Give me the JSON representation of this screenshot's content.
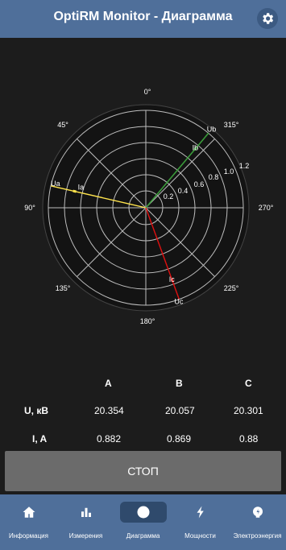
{
  "appbar": {
    "title": "OptiRM Monitor - Диаграмма",
    "settings_icon": "gear-icon"
  },
  "diagram": {
    "angle_labels": {
      "a0": "0°",
      "a45": "45°",
      "a90": "90°",
      "a135": "135°",
      "a180": "180°",
      "a225": "225°",
      "a270": "270°",
      "a315": "315°"
    },
    "radius_labels": [
      "0.2",
      "0.4",
      "0.6",
      "0.8",
      "1.0",
      "1.2"
    ],
    "vectors": {
      "Ua": {
        "label": "Ua",
        "angle_deg": 77,
        "magnitude": 1.2,
        "color": "#ffe44d"
      },
      "Ia": {
        "label": "Ia",
        "angle_deg": 77,
        "magnitude": 0.9,
        "color": "#ffe44d"
      },
      "Ub": {
        "label": "Ub",
        "angle_deg": 320,
        "magnitude": 1.2,
        "color": "#3a9a3a"
      },
      "Ib": {
        "label": "Ib",
        "angle_deg": 320,
        "magnitude": 0.95,
        "color": "#3a9a3a"
      },
      "Uc": {
        "label": "Uc",
        "angle_deg": 200,
        "magnitude": 1.2,
        "color": "#e01010"
      },
      "Ic": {
        "label": "Ic",
        "angle_deg": 200,
        "magnitude": 0.95,
        "color": "#e01010"
      }
    }
  },
  "table": {
    "headers": {
      "a": "A",
      "b": "B",
      "c": "C"
    },
    "rows": [
      {
        "label": "U, кВ",
        "a": "20.354",
        "b": "20.057",
        "c": "20.301"
      },
      {
        "label": "I, A",
        "a": "0.882",
        "b": "0.869",
        "c": "0.88"
      }
    ]
  },
  "stop_button": {
    "label": "СТОП"
  },
  "nav": {
    "items": [
      {
        "label": "Информация",
        "icon": "home-icon"
      },
      {
        "label": "Измерения",
        "icon": "bar-chart-icon"
      },
      {
        "label": "Диаграмма",
        "icon": "circle-icon"
      },
      {
        "label": "Мощности",
        "icon": "lightning-icon"
      },
      {
        "label": "Электроэнергия",
        "icon": "meter-icon"
      }
    ],
    "active_index": 2
  }
}
